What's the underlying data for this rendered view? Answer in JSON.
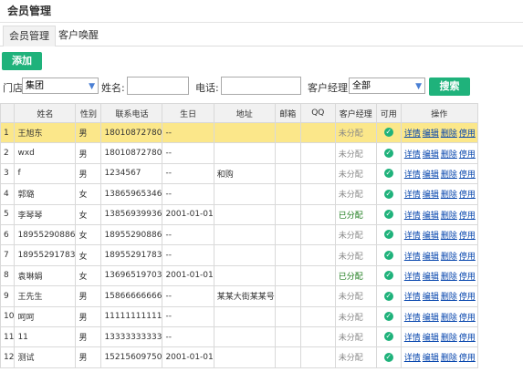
{
  "header": {
    "title": "会员管理"
  },
  "tabs": [
    {
      "label": "会员管理",
      "active": true
    },
    {
      "label": "客户唤醒",
      "active": false
    }
  ],
  "toolbar": {
    "add_label": "添加"
  },
  "filters": {
    "store_label": "门店",
    "store_value": "集团",
    "name_label": "姓名:",
    "phone_label": "电话:",
    "manager_label": "客户经理:",
    "manager_value": "全部",
    "search_label": "搜索"
  },
  "table": {
    "headers": [
      "",
      "姓名",
      "性别",
      "联系电话",
      "生日",
      "地址",
      "邮箱",
      "QQ",
      "客户经理",
      "可用",
      "操作"
    ],
    "actions": [
      "详情",
      "编辑",
      "删除",
      "停用"
    ],
    "rows": [
      {
        "no": "1",
        "name": "王旭东",
        "gender": "男",
        "phone": "18010872780",
        "birthday": "--",
        "address": "",
        "email": "",
        "qq": "",
        "manager": "未分配"
      },
      {
        "no": "2",
        "name": "wxd",
        "gender": "男",
        "phone": "18010872780",
        "birthday": "--",
        "address": "",
        "email": "",
        "qq": "",
        "manager": "未分配"
      },
      {
        "no": "3",
        "name": "f",
        "gender": "男",
        "phone": "1234567",
        "birthday": "--",
        "address": "和购",
        "email": "",
        "qq": "",
        "manager": "未分配"
      },
      {
        "no": "4",
        "name": "郭璐",
        "gender": "女",
        "phone": "13865965346",
        "birthday": "--",
        "address": "",
        "email": "",
        "qq": "",
        "manager": "未分配"
      },
      {
        "no": "5",
        "name": "李琴琴",
        "gender": "女",
        "phone": "13856939936",
        "birthday": "2001-01-01",
        "address": "",
        "email": "",
        "qq": "",
        "manager": "已分配"
      },
      {
        "no": "6",
        "name": "18955290886",
        "gender": "女",
        "phone": "18955290886",
        "birthday": "--",
        "address": "",
        "email": "",
        "qq": "",
        "manager": "未分配"
      },
      {
        "no": "7",
        "name": "18955291783",
        "gender": "女",
        "phone": "18955291783",
        "birthday": "--",
        "address": "",
        "email": "",
        "qq": "",
        "manager": "未分配"
      },
      {
        "no": "8",
        "name": "袁琳娟",
        "gender": "女",
        "phone": "13696519703",
        "birthday": "2001-01-01",
        "address": "",
        "email": "",
        "qq": "",
        "manager": "已分配"
      },
      {
        "no": "9",
        "name": "王先生",
        "gender": "男",
        "phone": "15866666666",
        "birthday": "--",
        "address": "某某大街某某号",
        "email": "",
        "qq": "",
        "manager": "未分配"
      },
      {
        "no": "10",
        "name": "呵呵",
        "gender": "男",
        "phone": "11111111111",
        "birthday": "--",
        "address": "",
        "email": "",
        "qq": "",
        "manager": "未分配"
      },
      {
        "no": "11",
        "name": "11",
        "gender": "男",
        "phone": "13333333333",
        "birthday": "--",
        "address": "",
        "email": "",
        "qq": "",
        "manager": "未分配"
      },
      {
        "no": "12",
        "name": "测试",
        "gender": "男",
        "phone": "15215609750",
        "birthday": "2001-01-01",
        "address": "",
        "email": "",
        "qq": "",
        "manager": "未分配"
      }
    ]
  }
}
